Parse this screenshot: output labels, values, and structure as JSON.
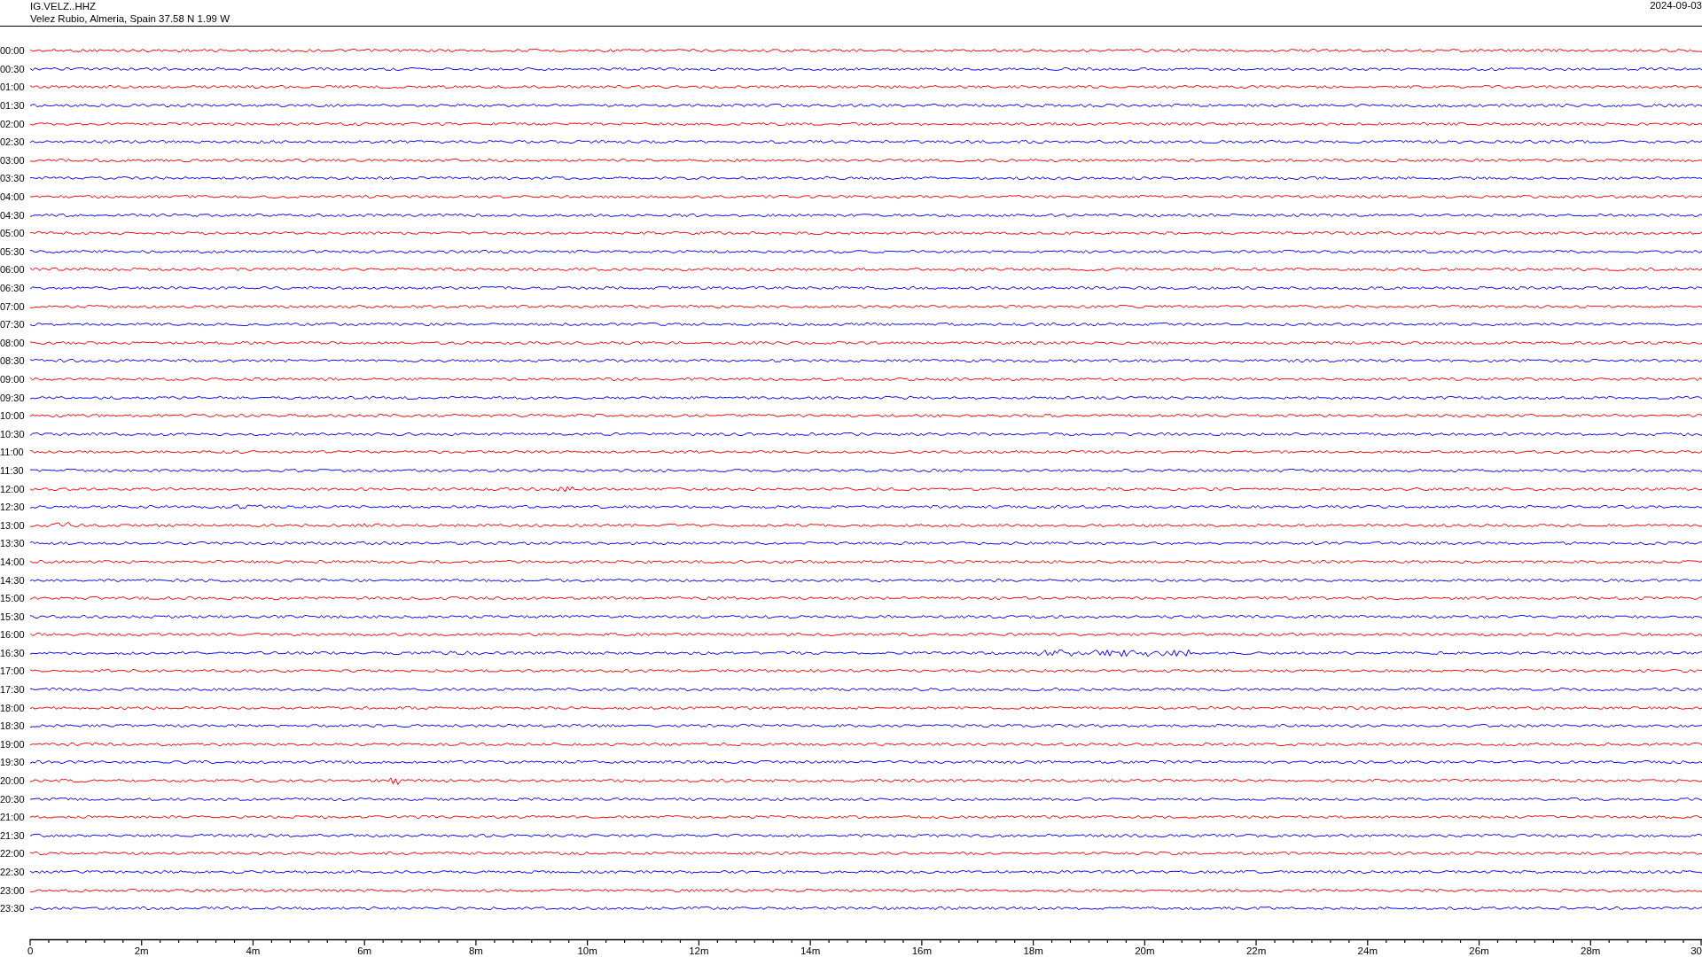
{
  "header": {
    "station": "IG.VELZ..HHZ",
    "location": "Velez Rubio, Almeria, Spain  37.58 N 1.99 W",
    "date": "2024-09-03"
  },
  "traces": [
    {
      "time": "00:00",
      "color": "#ff0000"
    },
    {
      "time": "00:30",
      "color": "#0000ff"
    },
    {
      "time": "01:00",
      "color": "#ff0000"
    },
    {
      "time": "01:30",
      "color": "#0000ff"
    },
    {
      "time": "02:00",
      "color": "#ff0000"
    },
    {
      "time": "02:30",
      "color": "#0000ff"
    },
    {
      "time": "03:00",
      "color": "#ff0000"
    },
    {
      "time": "03:30",
      "color": "#0000ff"
    },
    {
      "time": "04:00",
      "color": "#ff0000"
    },
    {
      "time": "04:30",
      "color": "#0000ff"
    },
    {
      "time": "05:00",
      "color": "#ff0000"
    },
    {
      "time": "05:30",
      "color": "#0000ff"
    },
    {
      "time": "06:00",
      "color": "#ff0000"
    },
    {
      "time": "06:30",
      "color": "#0000ff"
    },
    {
      "time": "07:00",
      "color": "#ff0000"
    },
    {
      "time": "07:30",
      "color": "#0000ff"
    },
    {
      "time": "08:00",
      "color": "#ff0000"
    },
    {
      "time": "08:30",
      "color": "#0000ff"
    },
    {
      "time": "09:00",
      "color": "#ff0000"
    },
    {
      "time": "09:30",
      "color": "#0000ff"
    },
    {
      "time": "10:00",
      "color": "#ff0000"
    },
    {
      "time": "10:30",
      "color": "#0000ff"
    },
    {
      "time": "11:00",
      "color": "#ff0000"
    },
    {
      "time": "11:30",
      "color": "#0000ff"
    },
    {
      "time": "12:00",
      "color": "#ff0000"
    },
    {
      "time": "12:30",
      "color": "#0000ff"
    },
    {
      "time": "13:00",
      "color": "#ff0000"
    },
    {
      "time": "13:30",
      "color": "#0000ff"
    },
    {
      "time": "14:00",
      "color": "#ff0000"
    },
    {
      "time": "14:30",
      "color": "#0000ff"
    },
    {
      "time": "15:00",
      "color": "#ff0000"
    },
    {
      "time": "15:30",
      "color": "#0000ff"
    },
    {
      "time": "16:00",
      "color": "#ff0000"
    },
    {
      "time": "16:30",
      "color": "#0000ff"
    },
    {
      "time": "17:00",
      "color": "#ff0000"
    },
    {
      "time": "17:30",
      "color": "#0000ff"
    },
    {
      "time": "18:00",
      "color": "#ff0000"
    },
    {
      "time": "18:30",
      "color": "#0000ff"
    },
    {
      "time": "19:00",
      "color": "#ff0000"
    },
    {
      "time": "19:30",
      "color": "#0000ff"
    },
    {
      "time": "20:00",
      "color": "#ff0000"
    },
    {
      "time": "20:30",
      "color": "#0000ff"
    },
    {
      "time": "21:00",
      "color": "#ff0000"
    },
    {
      "time": "21:30",
      "color": "#0000ff"
    },
    {
      "time": "22:00",
      "color": "#ff0000"
    },
    {
      "time": "22:30",
      "color": "#0000ff"
    },
    {
      "time": "23:00",
      "color": "#ff0000"
    },
    {
      "time": "23:30",
      "color": "#0000ff"
    }
  ],
  "x_axis": {
    "ticks": [
      "0",
      "2m",
      "4m",
      "6m",
      "8m",
      "10m",
      "12m",
      "14m",
      "16m",
      "18m",
      "20m",
      "22m",
      "24m",
      "26m",
      "28m",
      "30"
    ]
  }
}
